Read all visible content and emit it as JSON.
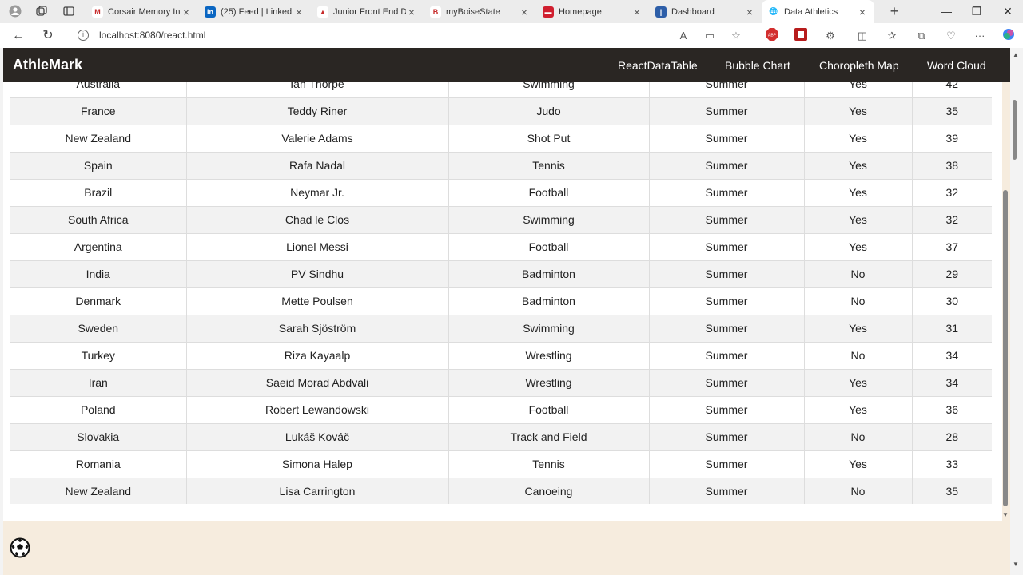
{
  "browser": {
    "tabs": [
      {
        "title": "Corsair Memory Inc",
        "fav_color": "#ffffff",
        "fav_text": "M"
      },
      {
        "title": "(25) Feed | LinkedIn",
        "fav_color": "#0a66c2",
        "fav_text": "in"
      },
      {
        "title": "Junior Front End Dev",
        "fav_color": "#ffffff",
        "fav_text": "▲"
      },
      {
        "title": "myBoiseState",
        "fav_color": "#ffffff",
        "fav_text": "B"
      },
      {
        "title": "Homepage",
        "fav_color": "#d01f2f",
        "fav_text": "▬"
      },
      {
        "title": "Dashboard",
        "fav_color": "#2d5ea8",
        "fav_text": "|"
      },
      {
        "title": "Data Athletics",
        "fav_color": "#ffffff",
        "fav_text": "🌐"
      }
    ],
    "url": "localhost:8080/react.html"
  },
  "app": {
    "brand": "AthleMark",
    "nav": [
      "ReactDataTable",
      "Bubble Chart",
      "Choropleth Map",
      "Word Cloud"
    ]
  },
  "table": {
    "rows": [
      [
        "Australia",
        "Ian Thorpe",
        "Swimming",
        "Summer",
        "Yes",
        "42"
      ],
      [
        "France",
        "Teddy Riner",
        "Judo",
        "Summer",
        "Yes",
        "35"
      ],
      [
        "New Zealand",
        "Valerie Adams",
        "Shot Put",
        "Summer",
        "Yes",
        "39"
      ],
      [
        "Spain",
        "Rafa Nadal",
        "Tennis",
        "Summer",
        "Yes",
        "38"
      ],
      [
        "Brazil",
        "Neymar Jr.",
        "Football",
        "Summer",
        "Yes",
        "32"
      ],
      [
        "South Africa",
        "Chad le Clos",
        "Swimming",
        "Summer",
        "Yes",
        "32"
      ],
      [
        "Argentina",
        "Lionel Messi",
        "Football",
        "Summer",
        "Yes",
        "37"
      ],
      [
        "India",
        "PV Sindhu",
        "Badminton",
        "Summer",
        "No",
        "29"
      ],
      [
        "Denmark",
        "Mette Poulsen",
        "Badminton",
        "Summer",
        "No",
        "30"
      ],
      [
        "Sweden",
        "Sarah Sjöström",
        "Swimming",
        "Summer",
        "Yes",
        "31"
      ],
      [
        "Turkey",
        "Riza Kayaalp",
        "Wrestling",
        "Summer",
        "No",
        "34"
      ],
      [
        "Iran",
        "Saeid Morad Abdvali",
        "Wrestling",
        "Summer",
        "Yes",
        "34"
      ],
      [
        "Poland",
        "Robert Lewandowski",
        "Football",
        "Summer",
        "Yes",
        "36"
      ],
      [
        "Slovakia",
        "Lukáš Kováč",
        "Track and Field",
        "Summer",
        "No",
        "28"
      ],
      [
        "Romania",
        "Simona Halep",
        "Tennis",
        "Summer",
        "Yes",
        "33"
      ],
      [
        "New Zealand",
        "Lisa Carrington",
        "Canoeing",
        "Summer",
        "No",
        "35"
      ]
    ]
  },
  "colors": {
    "nav_bg": "#2a2623",
    "footer_bg": "#f6ecde"
  }
}
